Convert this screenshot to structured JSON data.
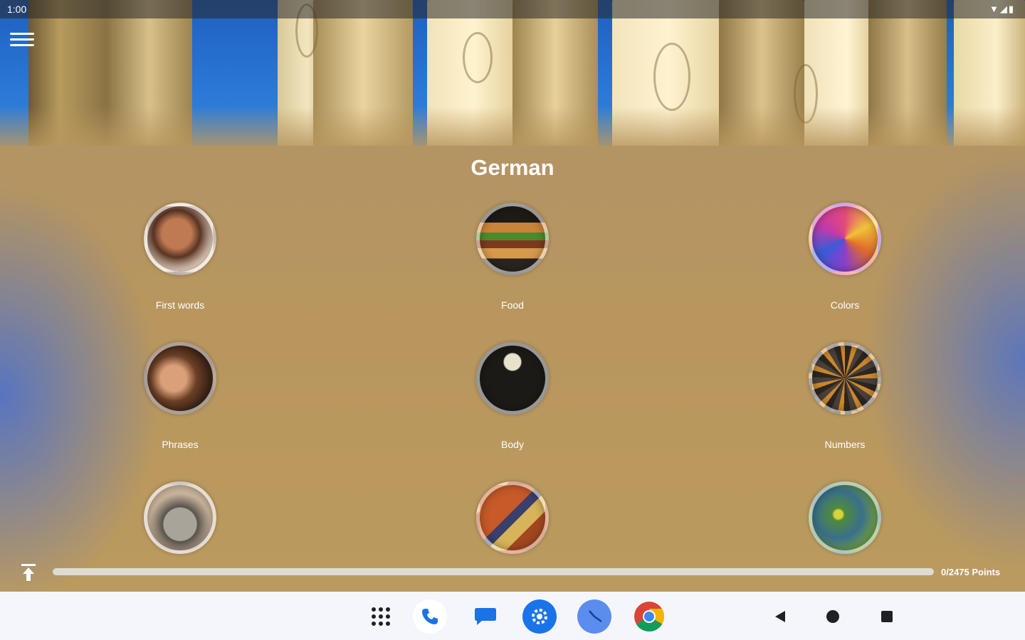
{
  "status_bar": {
    "time": "1:00",
    "icons": [
      "wifi-icon",
      "signal-icon",
      "battery-icon"
    ]
  },
  "header": {
    "menu_icon": "hamburger-menu-icon",
    "title": "German"
  },
  "categories": [
    {
      "label": "First words",
      "icon": "child-face-photo"
    },
    {
      "label": "Food",
      "icon": "burger-photo"
    },
    {
      "label": "Colors",
      "icon": "color-powder-photo"
    },
    {
      "label": "Phrases",
      "icon": "smiling-woman-photo"
    },
    {
      "label": "Body",
      "icon": "skeleton-photo"
    },
    {
      "label": "Numbers",
      "icon": "number-blocks-photo"
    },
    {
      "label": "",
      "icon": "alarm-clock-photo"
    },
    {
      "label": "",
      "icon": "shopping-photo"
    },
    {
      "label": "",
      "icon": "nature-photo"
    }
  ],
  "footer": {
    "scroll_top_icon": "scroll-to-top-icon",
    "progress": 0,
    "points_text": "0/2475 Points"
  },
  "nav": {
    "dock": [
      "apps-grid-icon",
      "phone-icon",
      "messages-icon",
      "settings-icon",
      "clock-icon",
      "chrome-icon"
    ],
    "system": [
      "back-icon",
      "home-icon",
      "recents-icon"
    ]
  },
  "colors": {
    "background": "#b8965e",
    "accent_blue": "#1a73e8",
    "navbar": "#f5f6fb"
  }
}
